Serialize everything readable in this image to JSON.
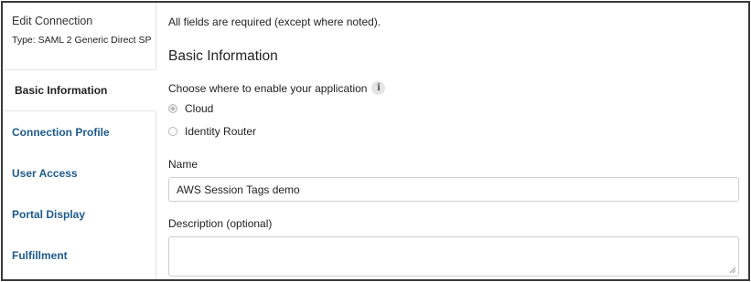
{
  "sidebar": {
    "title": "Edit Connection",
    "type_text": "Type: SAML 2 Generic Direct SP",
    "items": [
      {
        "label": "Basic Information"
      },
      {
        "label": "Connection Profile"
      },
      {
        "label": "User Access"
      },
      {
        "label": "Portal Display"
      },
      {
        "label": "Fulfillment"
      }
    ],
    "active_index": 0
  },
  "main": {
    "required_note": "All fields are required (except where noted).",
    "section_title": "Basic Information",
    "enable_label": "Choose where to enable your application",
    "info_icon_glyph": "i",
    "radio_options": [
      {
        "label": "Cloud",
        "checked": true
      },
      {
        "label": "Identity Router",
        "checked": false
      }
    ],
    "name_label": "Name",
    "name_value": "AWS Session Tags demo",
    "description_label": "Description (optional)",
    "description_value": ""
  },
  "colors": {
    "nav_link": "#1d5a8a",
    "frame_border": "#3a3a3a",
    "input_border": "#cfcfcf"
  }
}
